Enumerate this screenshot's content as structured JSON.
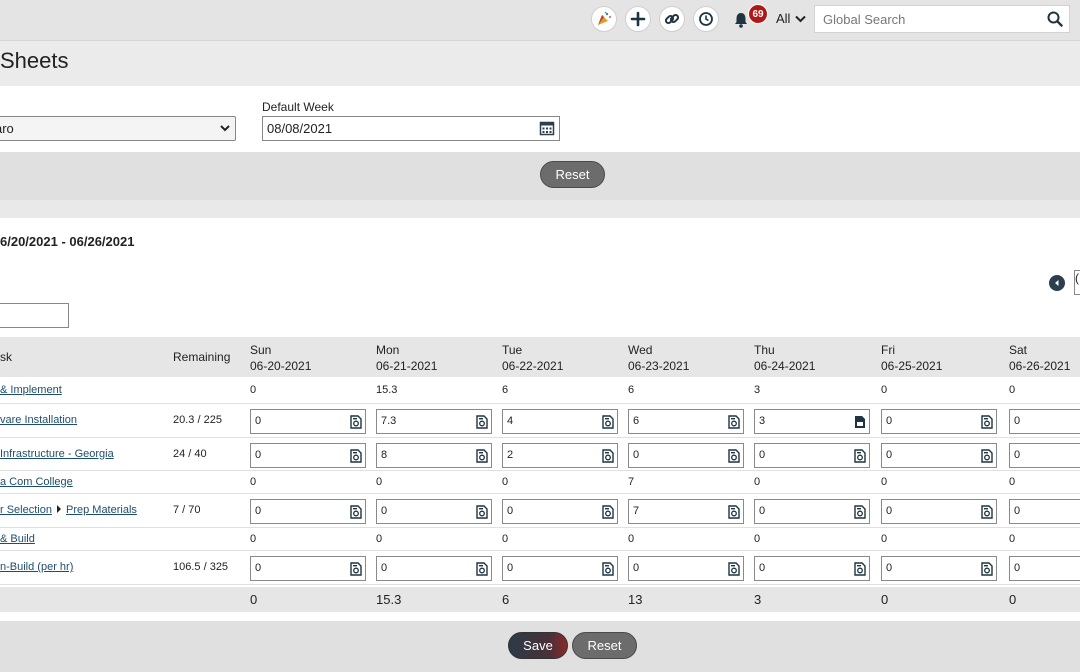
{
  "topbar": {
    "notifications_count": "69",
    "scope_label": "All",
    "search_placeholder": "Global Search"
  },
  "page": {
    "title": "Sheets"
  },
  "filters": {
    "user_select_value": "aro",
    "default_week_label": "Default Week",
    "default_week_value": "08/08/2021",
    "reset_label": "Reset"
  },
  "timesheet": {
    "date_range": "6/20/2021 - 06/26/2021",
    "week_box_value": "(",
    "columns": {
      "task": "sk",
      "remaining": "Remaining",
      "days": [
        {
          "day": "Sun",
          "date": "06-20-2021"
        },
        {
          "day": "Mon",
          "date": "06-21-2021"
        },
        {
          "day": "Tue",
          "date": "06-22-2021"
        },
        {
          "day": "Wed",
          "date": "06-23-2021"
        },
        {
          "day": "Thu",
          "date": "06-24-2021"
        },
        {
          "day": "Fri",
          "date": "06-25-2021"
        },
        {
          "day": "Sat",
          "date": "06-26-2021"
        }
      ]
    },
    "rows": [
      {
        "task": "& Implement",
        "remaining": "",
        "editable": false,
        "values": [
          "0",
          "15.3",
          "6",
          "6",
          "3",
          "0",
          "0"
        ]
      },
      {
        "task": "vare Installation",
        "remaining": "20.3 / 225",
        "editable": true,
        "values": [
          "0",
          "7.3",
          "4",
          "6",
          "3",
          "0",
          "0"
        ]
      },
      {
        "task": "Infrastructure - Georgia",
        "remaining": "24 / 40",
        "editable": true,
        "values": [
          "0",
          "8",
          "2",
          "0",
          "0",
          "0",
          "0"
        ]
      },
      {
        "task": "a Com College",
        "remaining": "",
        "editable": false,
        "values": [
          "0",
          "0",
          "0",
          "7",
          "0",
          "0",
          "0"
        ]
      },
      {
        "task": "r Selection",
        "task_sub": "Prep Materials",
        "remaining": "7 / 70",
        "editable": true,
        "values": [
          "0",
          "0",
          "0",
          "7",
          "0",
          "0",
          "0"
        ]
      },
      {
        "task": "& Build",
        "remaining": "",
        "editable": false,
        "values": [
          "0",
          "0",
          "0",
          "0",
          "0",
          "0",
          "0"
        ]
      },
      {
        "task": "n-Build (per hr)",
        "remaining": "106.5 / 325",
        "editable": true,
        "values": [
          "0",
          "0",
          "0",
          "0",
          "0",
          "0",
          "0"
        ]
      }
    ],
    "totals": [
      "0",
      "15.3",
      "6",
      "13",
      "3",
      "0",
      "0"
    ]
  },
  "actions": {
    "save_label": "Save",
    "reset_label": "Reset"
  },
  "colors": {
    "accent_dark": "#2d3f4e",
    "link": "#1e4e6e",
    "badge": "#b01818"
  }
}
